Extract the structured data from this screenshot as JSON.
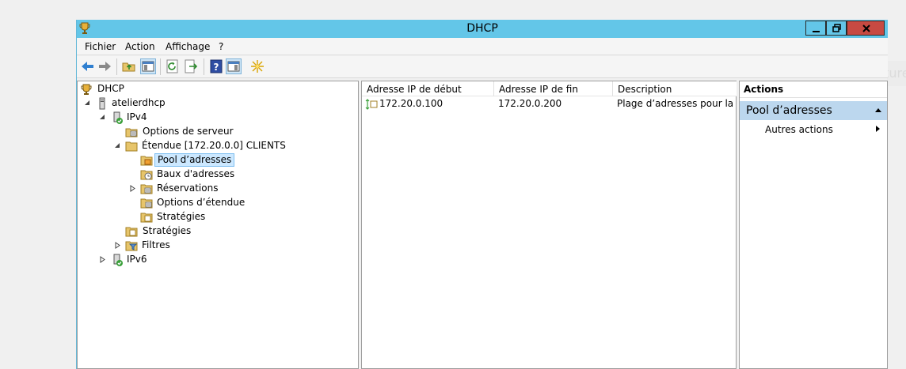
{
  "window": {
    "title": "DHCP"
  },
  "menu": [
    "Fichier",
    "Action",
    "Affichage",
    "?"
  ],
  "toolbar": {
    "buttons": [
      "back-icon",
      "forward-icon",
      "folder-up-icon",
      "show-hide-tree-icon",
      "refresh-icon",
      "export-icon",
      "help-icon",
      "show-hide-action-pane-icon",
      "new-star-icon"
    ]
  },
  "tree": {
    "root": "DHCP",
    "server": "atelierdhcp",
    "ipv4": "IPv4",
    "server_options": "Options de serveur",
    "scope": "Étendue [172.20.0.0] CLIENTS",
    "pool": "Pool d’adresses",
    "leases": "Baux d'adresses",
    "reservations": "Réservations",
    "scope_options": "Options d’étendue",
    "scope_policies": "Stratégies",
    "policies": "Stratégies",
    "filters": "Filtres",
    "ipv6": "IPv6"
  },
  "list": {
    "columns": [
      "Adresse IP de début",
      "Adresse IP de fin",
      "Description"
    ],
    "rows": [
      {
        "start": "172.20.0.100",
        "end": "172.20.0.200",
        "description": "Plage d’adresses pour la distribution"
      }
    ]
  },
  "actions": {
    "header": "Actions",
    "group": "Pool d’adresses",
    "item": "Autres actions"
  },
  "background": {
    "capture_label": "Capture"
  },
  "colors": {
    "titlebar": "#63c6e8",
    "close_button": "#c74a42",
    "selection": "#cce8ff",
    "actions_group": "#bcd7ee"
  }
}
